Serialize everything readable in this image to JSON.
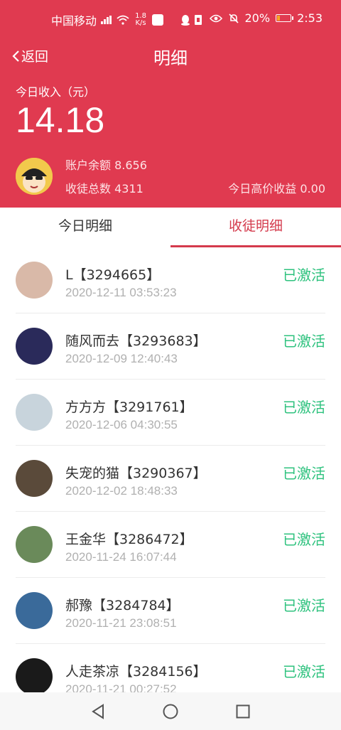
{
  "status_bar": {
    "carrier": "中国移动",
    "net_speed_value": "1.8",
    "net_speed_unit": "K/s",
    "battery_percent": "20%",
    "battery_level": 0.2,
    "time": "2:53"
  },
  "nav": {
    "back_label": "返回",
    "title": "明细"
  },
  "summary": {
    "income_label": "今日收入（元）",
    "income_value": "14.18",
    "balance": "账户余额 8.656",
    "recruits": "收徒总数 4311",
    "high_price_income": "今日高价收益 0.00"
  },
  "tabs": [
    {
      "label": "今日明细",
      "active": false
    },
    {
      "label": "收徒明细",
      "active": true
    }
  ],
  "records": [
    {
      "name": "L【3294665】",
      "time": "2020-12-11 03:53:23",
      "status": "已激活",
      "avatar_color": "#d9b9a8"
    },
    {
      "name": "随风而去【3293683】",
      "time": "2020-12-09 12:40:43",
      "status": "已激活",
      "avatar_color": "#2a2a5a"
    },
    {
      "name": "方方方【3291761】",
      "time": "2020-12-06 04:30:55",
      "status": "已激活",
      "avatar_color": "#c8d4dc"
    },
    {
      "name": "失宠的猫【3290367】",
      "time": "2020-12-02 18:48:33",
      "status": "已激活",
      "avatar_color": "#5a4a3a"
    },
    {
      "name": "王金华【3286472】",
      "time": "2020-11-24 16:07:44",
      "status": "已激活",
      "avatar_color": "#6a8a5a"
    },
    {
      "name": "郝豫【3284784】",
      "time": "2020-11-21 23:08:51",
      "status": "已激活",
      "avatar_color": "#3a6a9a"
    },
    {
      "name": "人走茶凉【3284156】",
      "time": "2020-11-21 00:27:52",
      "status": "已激活",
      "avatar_color": "#1a1a1a"
    }
  ],
  "colors": {
    "accent": "#e03a50",
    "tab_active": "#d43a4c",
    "status_active": "#2ec27e"
  }
}
